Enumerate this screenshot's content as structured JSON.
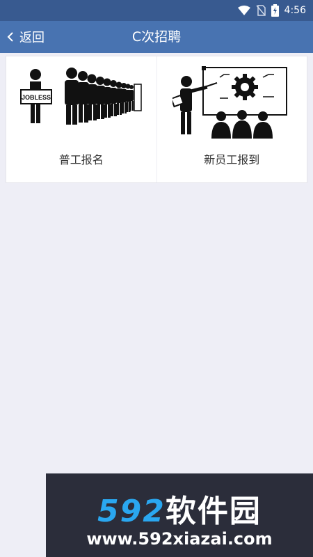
{
  "status_bar": {
    "time": "4:56",
    "icons": [
      "wifi-icon",
      "no-sim-icon",
      "battery-charging-icon"
    ]
  },
  "app_bar": {
    "back_label": "返回",
    "title": "C次招聘"
  },
  "menu": {
    "items": [
      {
        "label": "普工报名",
        "icon": "jobless-queue-illustration",
        "sign_text": "JOBLESS"
      },
      {
        "label": "新员工报到",
        "icon": "training-presentation-illustration"
      }
    ]
  },
  "watermark": {
    "brand_number": "592",
    "brand_name": "软件园",
    "url": "www.592xiazai.com"
  },
  "colors": {
    "status_bar": "#385a90",
    "app_bar": "#4873b1",
    "background": "#eeeef6",
    "watermark_bg": "#2b2d3a",
    "watermark_accent": "#2aa7f0"
  }
}
